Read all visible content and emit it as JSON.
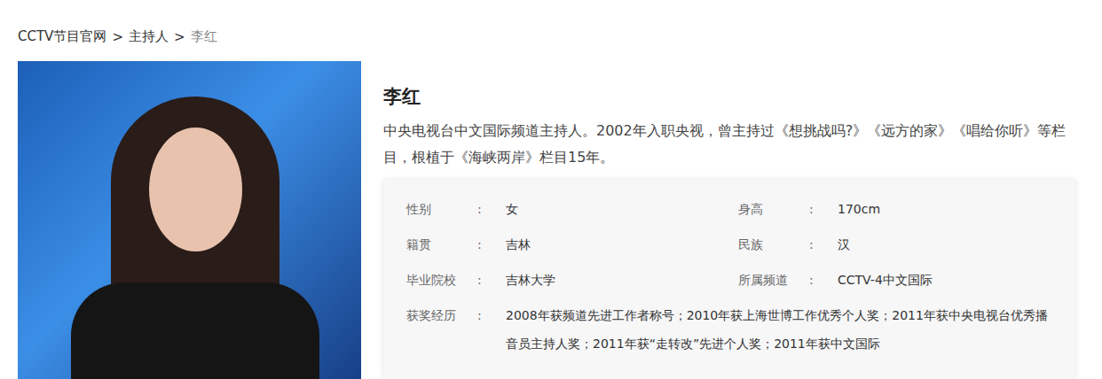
{
  "breadcrumb": [
    {
      "label": "CCTV节目官网",
      "current": false
    },
    {
      "label": ">",
      "current": false
    },
    {
      "label": "主持人",
      "current": false
    },
    {
      "label": ">",
      "current": false
    },
    {
      "label": "李红",
      "current": true
    }
  ],
  "profile": {
    "name": "李红",
    "description": "中央电视台中文国际频道主持人。2002年入职央视，曾主持过《想挑战吗?》《远方的家》《唱给你听》等栏目，根植于《海峡两岸》栏目15年。",
    "fields": [
      {
        "label": "性别",
        "colon": ":",
        "value": "女"
      },
      {
        "label": "身高",
        "colon": ":",
        "value": "170cm"
      },
      {
        "label": "籍贯",
        "colon": ":",
        "value": "吉林"
      },
      {
        "label": "民族",
        "colon": ":",
        "value": "汉"
      },
      {
        "label": "毕业院校",
        "colon": ":",
        "value": "吉林大学"
      },
      {
        "label": "所属频道",
        "colon": ":",
        "value": "CCTV-4中文国际"
      }
    ],
    "awards": {
      "label": "获奖经历",
      "colon": ":",
      "value": "2008年获频道先进工作者称号；2010年获上海世博工作优秀个人奖；2011年获中央电视台优秀播音员主持人奖；2011年获“走转改”先进个人奖；2011年获中文国际"
    }
  }
}
